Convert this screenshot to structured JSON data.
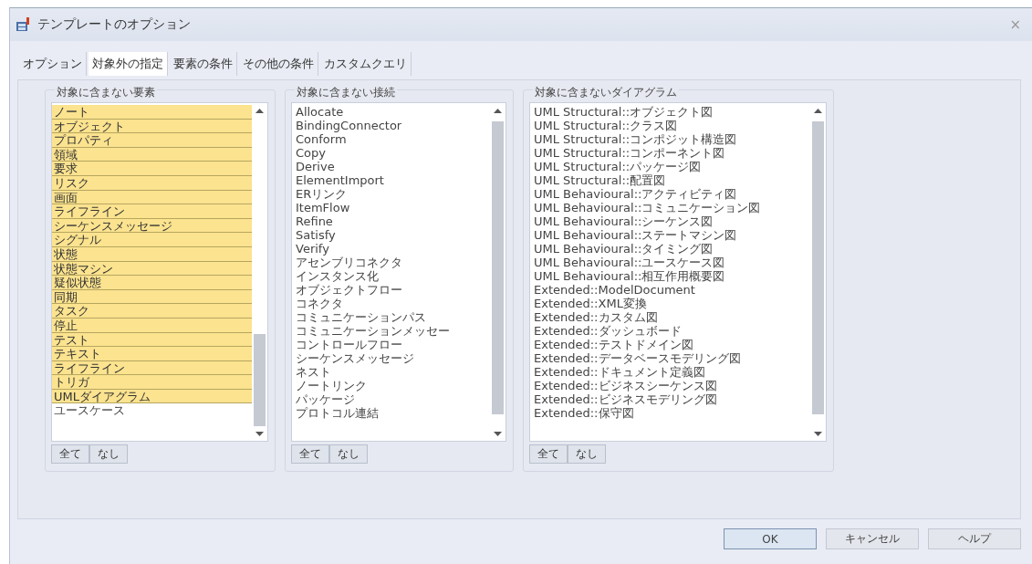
{
  "window": {
    "title": "テンプレートのオプション",
    "close": "×"
  },
  "tabs": [
    {
      "label": "オプション",
      "selected": false
    },
    {
      "label": "対象外の指定",
      "selected": true
    },
    {
      "label": "要素の条件",
      "selected": false
    },
    {
      "label": "その他の条件",
      "selected": false
    },
    {
      "label": "カスタムクエリ",
      "selected": false
    }
  ],
  "groups": [
    {
      "title": "対象に含まない要素",
      "items": [
        {
          "label": "ノート",
          "selected": true
        },
        {
          "label": "オブジェクト",
          "selected": true
        },
        {
          "label": "プロパティ",
          "selected": true
        },
        {
          "label": "領域",
          "selected": true
        },
        {
          "label": "要求",
          "selected": true
        },
        {
          "label": "リスク",
          "selected": true
        },
        {
          "label": "画面",
          "selected": true
        },
        {
          "label": "ライフライン",
          "selected": true
        },
        {
          "label": "シーケンスメッセージ",
          "selected": true
        },
        {
          "label": "シグナル",
          "selected": true
        },
        {
          "label": "状態",
          "selected": true
        },
        {
          "label": "状態マシン",
          "selected": true
        },
        {
          "label": "疑似状態",
          "selected": true
        },
        {
          "label": "同期",
          "selected": true
        },
        {
          "label": "タスク",
          "selected": true
        },
        {
          "label": "停止",
          "selected": true
        },
        {
          "label": "テスト",
          "selected": true
        },
        {
          "label": "テキスト",
          "selected": true
        },
        {
          "label": "ライフライン",
          "selected": true
        },
        {
          "label": "トリガ",
          "selected": true
        },
        {
          "label": "UMLダイアグラム",
          "selected": true
        },
        {
          "label": "ユースケース",
          "selected": false
        }
      ],
      "buttons": [
        "全て",
        "なし"
      ]
    },
    {
      "title": "対象に含まない接続",
      "items": [
        {
          "label": "Allocate",
          "selected": false
        },
        {
          "label": "BindingConnector",
          "selected": false
        },
        {
          "label": "Conform",
          "selected": false
        },
        {
          "label": "Copy",
          "selected": false
        },
        {
          "label": "Derive",
          "selected": false
        },
        {
          "label": "ElementImport",
          "selected": false
        },
        {
          "label": "ERリンク",
          "selected": false
        },
        {
          "label": "ItemFlow",
          "selected": false
        },
        {
          "label": "Refine",
          "selected": false
        },
        {
          "label": "Satisfy",
          "selected": false
        },
        {
          "label": "Verify",
          "selected": false
        },
        {
          "label": "アセンブリコネクタ",
          "selected": false
        },
        {
          "label": "インスタンス化",
          "selected": false
        },
        {
          "label": "オブジェクトフロー",
          "selected": false
        },
        {
          "label": "コネクタ",
          "selected": false
        },
        {
          "label": "コミュニケーションパス",
          "selected": false
        },
        {
          "label": "コミュニケーションメッセー",
          "selected": false
        },
        {
          "label": "コントロールフロー",
          "selected": false
        },
        {
          "label": "シーケンスメッセージ",
          "selected": false
        },
        {
          "label": "ネスト",
          "selected": false
        },
        {
          "label": "ノートリンク",
          "selected": false
        },
        {
          "label": "パッケージ",
          "selected": false
        },
        {
          "label": "プロトコル連結",
          "selected": false
        }
      ],
      "buttons": [
        "全て",
        "なし"
      ]
    },
    {
      "title": "対象に含まないダイアグラム",
      "items": [
        {
          "label": "UML Structural::オブジェクト図",
          "selected": false
        },
        {
          "label": "UML Structural::クラス図",
          "selected": false
        },
        {
          "label": "UML Structural::コンポジット構造図",
          "selected": false
        },
        {
          "label": "UML Structural::コンポーネント図",
          "selected": false
        },
        {
          "label": "UML Structural::パッケージ図",
          "selected": false
        },
        {
          "label": "UML Structural::配置図",
          "selected": false
        },
        {
          "label": "UML Behavioural::アクティビティ図",
          "selected": false
        },
        {
          "label": "UML Behavioural::コミュニケーション図",
          "selected": false
        },
        {
          "label": "UML Behavioural::シーケンス図",
          "selected": false
        },
        {
          "label": "UML Behavioural::ステートマシン図",
          "selected": false
        },
        {
          "label": "UML Behavioural::タイミング図",
          "selected": false
        },
        {
          "label": "UML Behavioural::ユースケース図",
          "selected": false
        },
        {
          "label": "UML Behavioural::相互作用概要図",
          "selected": false
        },
        {
          "label": "Extended::ModelDocument",
          "selected": false
        },
        {
          "label": "Extended::XML変換",
          "selected": false
        },
        {
          "label": "Extended::カスタム図",
          "selected": false
        },
        {
          "label": "Extended::ダッシュボード",
          "selected": false
        },
        {
          "label": "Extended::テストドメイン図",
          "selected": false
        },
        {
          "label": "Extended::データベースモデリング図",
          "selected": false
        },
        {
          "label": "Extended::ドキュメント定義図",
          "selected": false
        },
        {
          "label": "Extended::ビジネスシーケンス図",
          "selected": false
        },
        {
          "label": "Extended::ビジネスモデリング図",
          "selected": false
        },
        {
          "label": "Extended::保守図",
          "selected": false
        }
      ],
      "buttons": [
        "全て",
        "なし"
      ]
    }
  ],
  "footer_buttons": [
    {
      "label": "OK",
      "default": true
    },
    {
      "label": "キャンセル",
      "default": false
    },
    {
      "label": "ヘルプ",
      "default": false
    }
  ]
}
